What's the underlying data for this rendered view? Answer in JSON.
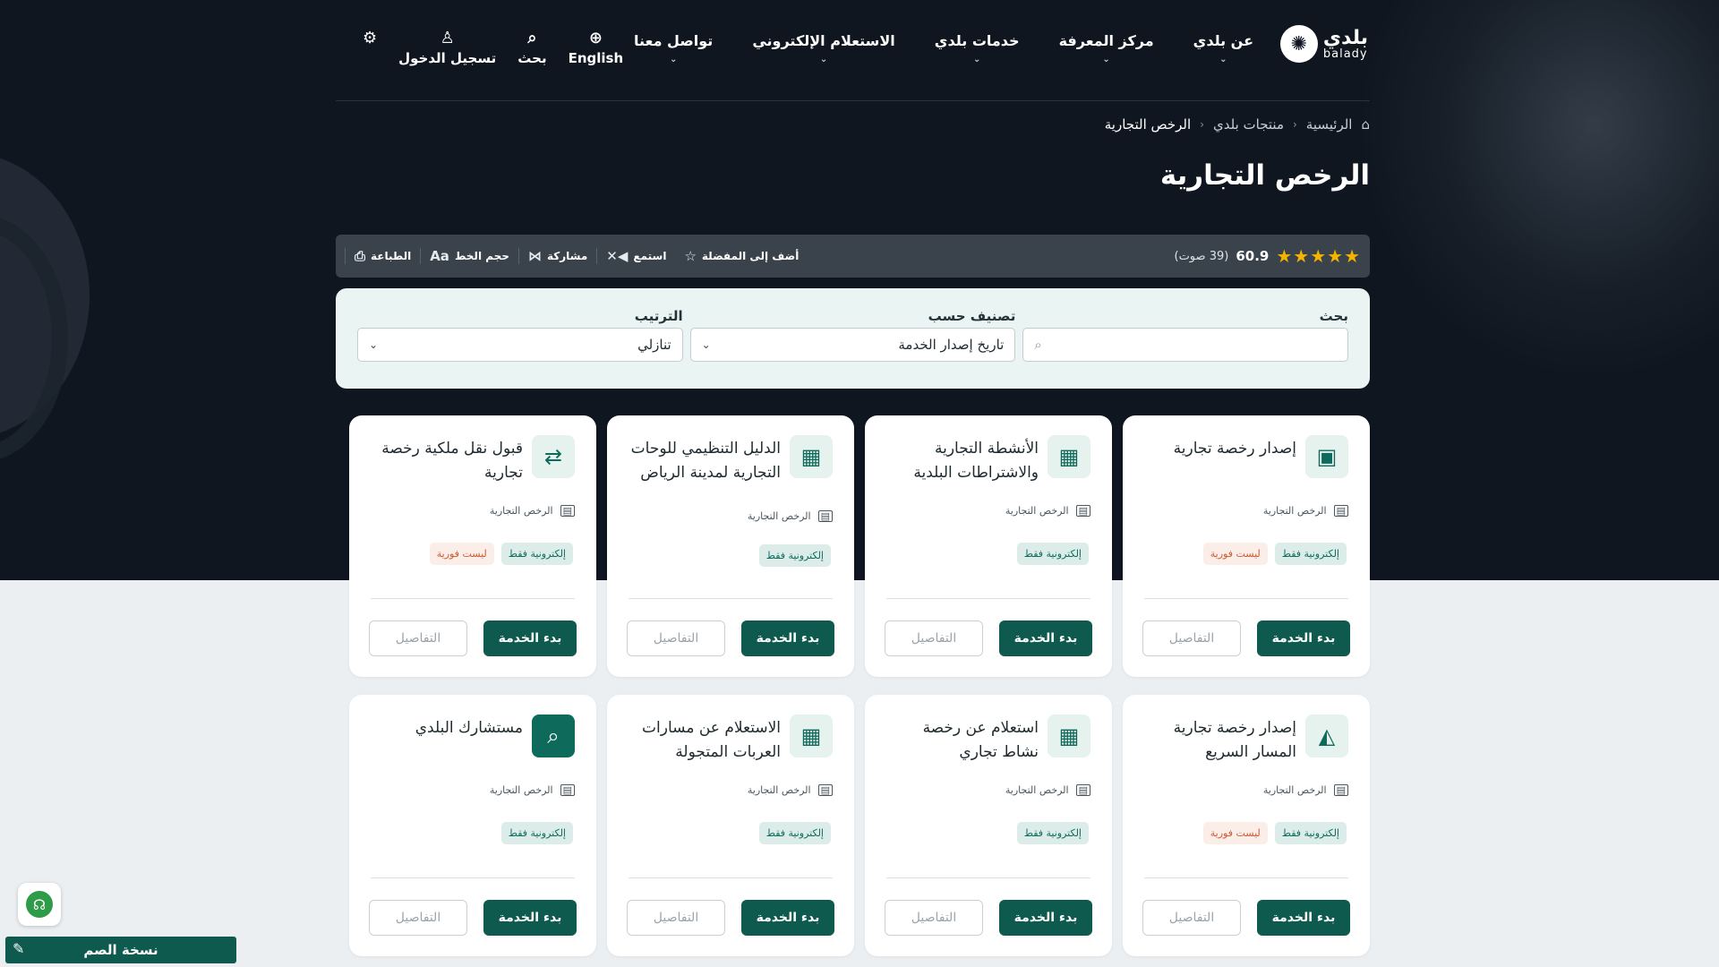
{
  "header": {
    "logo_ar": "بلدي",
    "logo_en": "balady",
    "nav": [
      "عن بلدي",
      "مركز المعرفة",
      "خدمات بلدي",
      "الاستعلام الإلكتروني",
      "تواصل معنا"
    ],
    "util": {
      "language": "English",
      "search": "بحث",
      "login": "تسجيل الدخول"
    }
  },
  "breadcrumb": {
    "home": "الرئيسية",
    "products": "منتجات بلدي",
    "current": "الرخص التجارية"
  },
  "page_title": "الرخص التجارية",
  "rating": {
    "score": "60.9",
    "votes": "(39 صوت)",
    "stars": 5
  },
  "toolbar": {
    "favorite": "أضف إلى المفضلة",
    "listen": "استمع",
    "share": "مشاركة",
    "font_size": "حجم الخط",
    "print": "الطباعة"
  },
  "filter": {
    "search_label": "بحث",
    "search_value": "",
    "sort_by_label": "تصنيف حسب",
    "sort_by_value": "تاريخ إصدار الخدمة",
    "order_label": "الترتيب",
    "order_value": "تنازلي"
  },
  "cards": [
    {
      "title": "إصدار رخصة تجارية",
      "category": "الرخص التجارية",
      "tag_electronic": "إلكترونية فقط",
      "tag_not_instant": "ليست فورية",
      "start": "بدء الخدمة",
      "details": "التفاصيل",
      "icon": "monitor-license-icon"
    },
    {
      "title": "الأنشطة التجارية والاشتراطات البلدية",
      "category": "الرخص التجارية",
      "tag_electronic": "إلكترونية فقط",
      "start": "بدء الخدمة",
      "details": "التفاصيل",
      "icon": "clipboard-icon"
    },
    {
      "title": "الدليل التنظيمي للوحات التجارية لمدينة الرياض",
      "category": "الرخص التجارية",
      "tag_electronic": "إلكترونية فقط",
      "start": "بدء الخدمة",
      "details": "التفاصيل",
      "icon": "clipboard-icon"
    },
    {
      "title": "قبول نقل ملكية رخصة تجارية",
      "category": "الرخص التجارية",
      "tag_electronic": "إلكترونية فقط",
      "tag_not_instant": "ليست فورية",
      "start": "بدء الخدمة",
      "details": "التفاصيل",
      "icon": "transfer-icon"
    },
    {
      "title": "إصدار رخصة تجارية المسار السريع",
      "category": "الرخص التجارية",
      "tag_electronic": "إلكترونية فقط",
      "tag_not_instant": "ليست فورية",
      "start": "بدء الخدمة",
      "details": "التفاصيل",
      "icon": "fast-track-icon"
    },
    {
      "title": "استعلام عن رخصة نشاط تجاري",
      "category": "الرخص التجارية",
      "tag_electronic": "إلكترونية فقط",
      "start": "بدء الخدمة",
      "details": "التفاصيل",
      "icon": "clipboard-icon"
    },
    {
      "title": "الاستعلام عن مسارات العربات المتجولة",
      "category": "الرخص التجارية",
      "tag_electronic": "إلكترونية فقط",
      "start": "بدء الخدمة",
      "details": "التفاصيل",
      "icon": "clipboard-icon"
    },
    {
      "title": "مستشارك البلدي",
      "category": "الرخص التجارية",
      "tag_electronic": "إلكترونية فقط",
      "start": "بدء الخدمة",
      "details": "التفاصيل",
      "icon": "advisor-icon"
    }
  ],
  "deaf_version": "نسخة الصم",
  "colors": {
    "primary": "#0e5a4e",
    "hero_bg": "#0f1620",
    "star": "#f4b400",
    "not_instant": "#cc5a33"
  }
}
